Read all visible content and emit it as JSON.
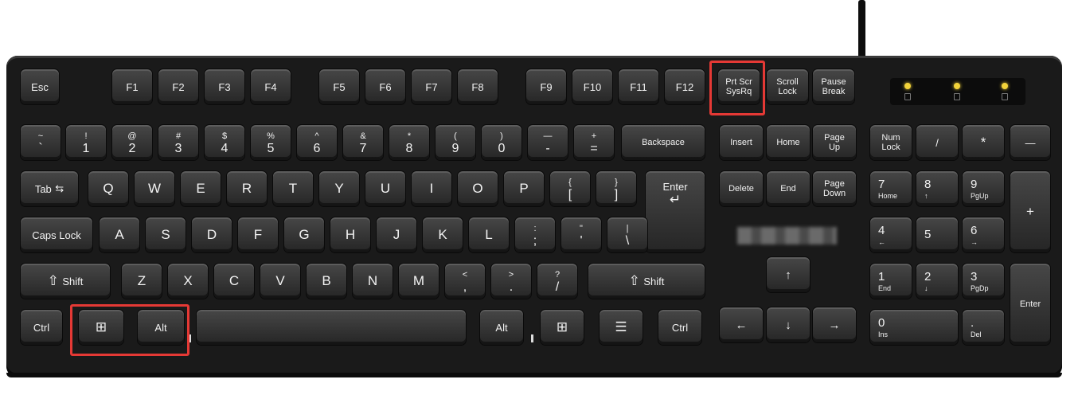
{
  "function_row": {
    "esc": "Esc",
    "f1": "F1",
    "f2": "F2",
    "f3": "F3",
    "f4": "F4",
    "f5": "F5",
    "f6": "F6",
    "f7": "F7",
    "f8": "F8",
    "f9": "F9",
    "f10": "F10",
    "f11": "F11",
    "f12": "F12",
    "prtscr": "Prt Scr\nSysRq",
    "scroll_lock": "Scroll\nLock",
    "pause": "Pause\nBreak"
  },
  "number_row": {
    "tilde": {
      "u": "~",
      "l": "`"
    },
    "k1": {
      "u": "!",
      "l": "1"
    },
    "k2": {
      "u": "@",
      "l": "2"
    },
    "k3": {
      "u": "#",
      "l": "3"
    },
    "k4": {
      "u": "$",
      "l": "4"
    },
    "k5": {
      "u": "%",
      "l": "5"
    },
    "k6": {
      "u": "^",
      "l": "6"
    },
    "k7": {
      "u": "&",
      "l": "7"
    },
    "k8": {
      "u": "*",
      "l": "8"
    },
    "k9": {
      "u": "(",
      "l": "9"
    },
    "k0": {
      "u": ")",
      "l": "0"
    },
    "minus": {
      "u": "—",
      "l": "-"
    },
    "equals": {
      "u": "+",
      "l": "="
    },
    "backspace": "Backspace"
  },
  "qwerty_row": {
    "tab": "Tab",
    "tab_arrow": "⇆",
    "q": "Q",
    "w": "W",
    "e": "E",
    "r": "R",
    "t": "T",
    "y": "Y",
    "u": "U",
    "i": "I",
    "o": "O",
    "p": "P",
    "lbracket": {
      "u": "{",
      "l": "["
    },
    "rbracket": {
      "u": "}",
      "l": "]"
    },
    "enter": "Enter",
    "enter_arrow": "↵"
  },
  "home_row": {
    "caps": "Caps Lock",
    "a": "A",
    "s": "S",
    "d": "D",
    "f": "F",
    "g": "G",
    "h": "H",
    "j": "J",
    "k": "K",
    "l": "L",
    "semicolon": {
      "u": ":",
      "l": ";"
    },
    "quote": {
      "u": "\"",
      "l": "'"
    },
    "backslash": {
      "u": "|",
      "l": "\\"
    }
  },
  "shift_row": {
    "lshift": "Shift",
    "shift_icon": "⇧",
    "z": "Z",
    "x": "X",
    "c": "C",
    "v": "V",
    "b": "B",
    "n": "N",
    "m": "M",
    "comma": {
      "u": "<",
      "l": ","
    },
    "period": {
      "u": ">",
      "l": "."
    },
    "slash": {
      "u": "?",
      "l": "/"
    },
    "rshift": "Shift"
  },
  "bottom_row": {
    "lctrl": "Ctrl",
    "lwin": "⊞",
    "lalt": "Alt",
    "ralt": "Alt",
    "rwin": "⊞",
    "menu": "☰",
    "rctrl": "Ctrl"
  },
  "nav_cluster": {
    "insert": "Insert",
    "home": "Home",
    "pgup": "Page\nUp",
    "delete": "Delete",
    "end": "End",
    "pgdn": "Page\nDown",
    "up": "↑",
    "left": "←",
    "down": "↓",
    "right": "→"
  },
  "numpad": {
    "numlock": "Num\nLock",
    "divide": "/",
    "multiply": "*",
    "subtract": "—",
    "add": "+",
    "n7": {
      "u": "7",
      "l": "Home"
    },
    "n8": {
      "u": "8",
      "l": "↑"
    },
    "n9": {
      "u": "9",
      "l": "PgUp"
    },
    "n4": {
      "u": "4",
      "l": "←"
    },
    "n5": {
      "u": "5",
      "l": ""
    },
    "n6": {
      "u": "6",
      "l": "→"
    },
    "n1": {
      "u": "1",
      "l": "End"
    },
    "n2": {
      "u": "2",
      "l": "↓"
    },
    "n3": {
      "u": "3",
      "l": "PgDp"
    },
    "n0": {
      "u": "0",
      "l": "Ins"
    },
    "ndot": {
      "u": ".",
      "l": "Del"
    },
    "enter": "Enter"
  },
  "highlight_color": "#e53935"
}
